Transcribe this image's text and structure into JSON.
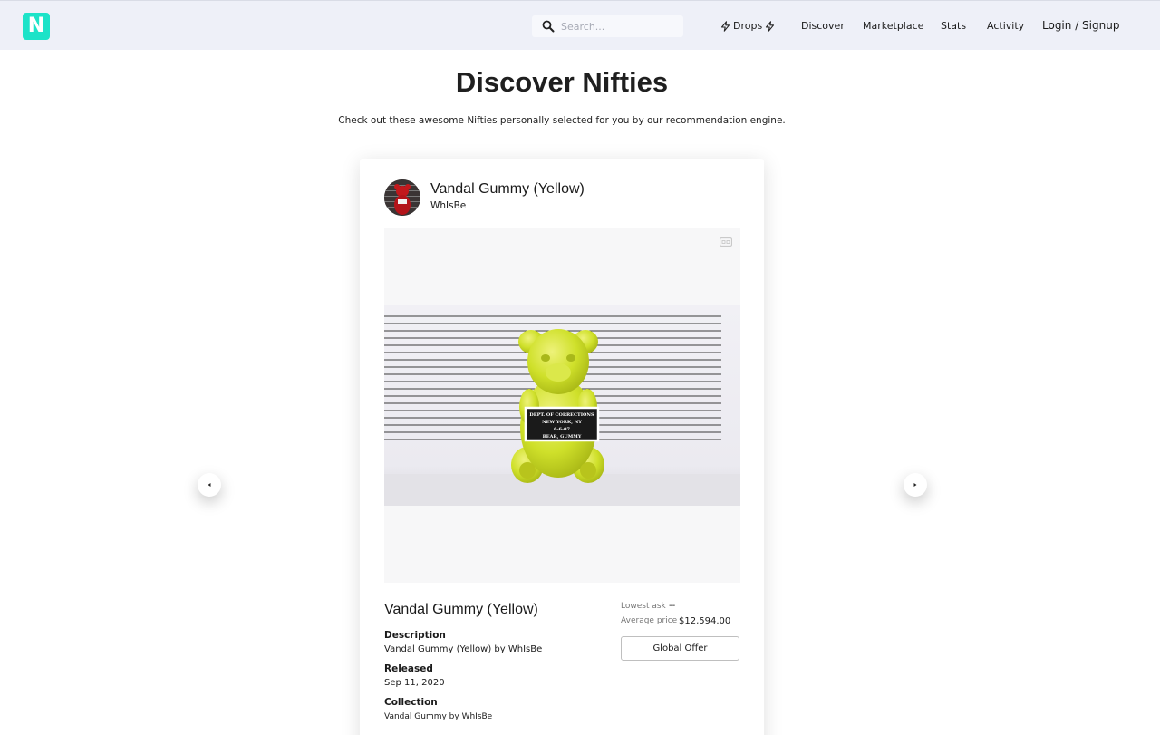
{
  "nav": {
    "logo_letter": "N",
    "search_placeholder": "Search...",
    "drops_label": "Drops",
    "discover_label": "Discover",
    "marketplace_label": "Marketplace",
    "stats_label": "Stats",
    "activity_label": "Activity",
    "login_label": "Login / Signup"
  },
  "header": {
    "title": "Discover Nifties",
    "subtitle": "Check out these awesome Nifties personally selected for you by our recommendation engine."
  },
  "card": {
    "title": "Vandal Gummy (Yellow)",
    "artist": "WhIsBe",
    "name": "Vandal Gummy (Yellow)",
    "description_label": "Description",
    "description": "Vandal Gummy (Yellow) by WhIsBe",
    "released_label": "Released",
    "released": "Sep 11, 2020",
    "collection_label": "Collection",
    "collection": "Vandal Gummy by WhIsBe",
    "lowest_ask_label": "Lowest ask",
    "lowest_ask": "--",
    "average_price_label": "Average price",
    "average_price": "$12,594.00",
    "offer_button": "Global Offer",
    "artwork_sign": [
      "DEPT. OF CORRECTIONS",
      "NEW YORK, NY",
      "6-6-07",
      "BEAR, GUMMY"
    ]
  },
  "colors": {
    "brand": "#1de3c8",
    "navbar_bg": "#eef0f8",
    "gummy": "#cfe02a"
  }
}
